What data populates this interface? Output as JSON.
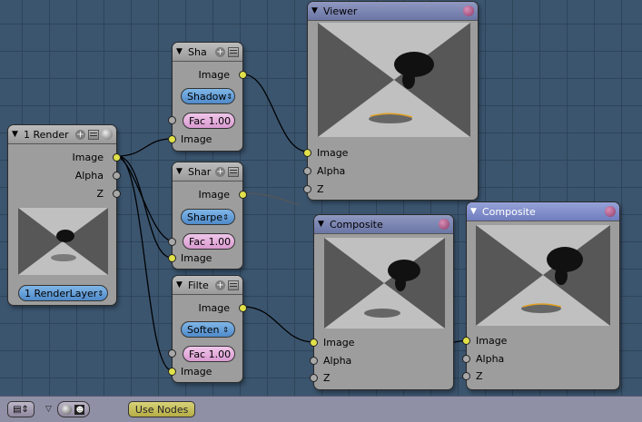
{
  "nodes": {
    "render": {
      "title": "1 Render",
      "outputs": [
        "Image",
        "Alpha",
        "Z"
      ],
      "layer_select": "1 RenderLayer"
    },
    "shadow": {
      "title": "Sha",
      "output": "Image",
      "mode": "Shadow",
      "fac": "Fac 1.00",
      "input": "Image"
    },
    "sharpen": {
      "title": "Shar",
      "output": "Image",
      "mode": "Sharpe",
      "fac": "Fac 1.00",
      "input": "Image"
    },
    "filter": {
      "title": "Filte",
      "output": "Image",
      "mode": "Soften",
      "fac": "Fac 1.00",
      "input": "Image"
    },
    "viewer": {
      "title": "Viewer",
      "inputs": [
        "Image",
        "Alpha",
        "Z"
      ]
    },
    "composite1": {
      "title": "Composite",
      "inputs": [
        "Image",
        "Alpha",
        "Z"
      ]
    },
    "composite2": {
      "title": "Composite",
      "inputs": [
        "Image",
        "Alpha",
        "Z"
      ]
    }
  },
  "bottom_bar": {
    "use_nodes_label": "Use Nodes"
  },
  "icons": [
    "collapse-triangle-icon",
    "add-icon",
    "list-icon",
    "preview-ball-icon",
    "editor-type-icon",
    "material-ball-icon",
    "composite-icon"
  ],
  "colors": {
    "socket_image": "#e1e14a",
    "socket_other": "#a8a8a8",
    "wire": "#000000",
    "selected_header": "#6f7dbf"
  }
}
